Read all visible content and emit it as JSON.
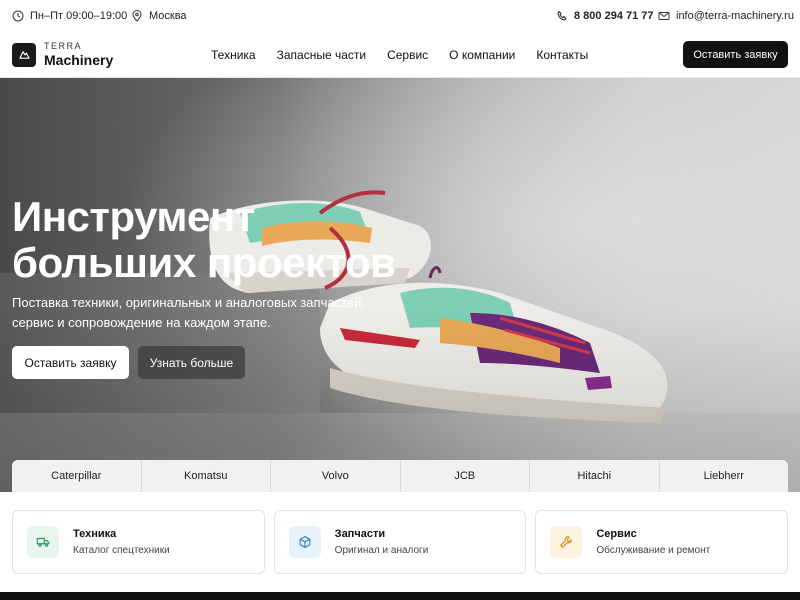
{
  "topbar": {
    "hours": "Пн–Пт 09:00–19:00",
    "city": "Москва",
    "phone": "8 800 294 71 77",
    "email": "info@terra-machinery.ru",
    "icons": [
      "clock-icon",
      "location-pin-icon",
      "phone-icon",
      "mail-icon"
    ]
  },
  "header": {
    "logo_top": "TERRA",
    "logo_bottom": "Machinery",
    "nav": [
      "Техника",
      "Запасные части",
      "Сервис",
      "О компании",
      "Контакты"
    ],
    "cta_label": "Оставить заявку"
  },
  "hero": {
    "title_line1": "Инструмент",
    "title_line2": "больших проектов",
    "subtitle": "Поставка техники, оригинальных и аналоговых запчастей, сервис и сопровождение на каждом этапе.",
    "primary_button": "Оставить заявку",
    "secondary_button": "Узнать больше"
  },
  "brands": [
    "Caterpillar",
    "Komatsu",
    "Volvo",
    "JCB",
    "Hitachi",
    "Liebherr"
  ],
  "cards": [
    {
      "title": "Техника",
      "desc": "Каталог спецтехники",
      "icon": "truck-icon",
      "color": "#1f9d55",
      "bg": "#e8f7ee"
    },
    {
      "title": "Запчасти",
      "desc": "Оригинал и аналоги",
      "icon": "box-icon",
      "color": "#2b7fc4",
      "bg": "#e8f2fb"
    },
    {
      "title": "Сервис",
      "desc": "Обслуживание и ремонт",
      "icon": "wrench-icon",
      "color": "#d08a10",
      "bg": "#fdf3e1"
    }
  ],
  "colors": {
    "accent": "#111111",
    "background": "#ffffff"
  }
}
